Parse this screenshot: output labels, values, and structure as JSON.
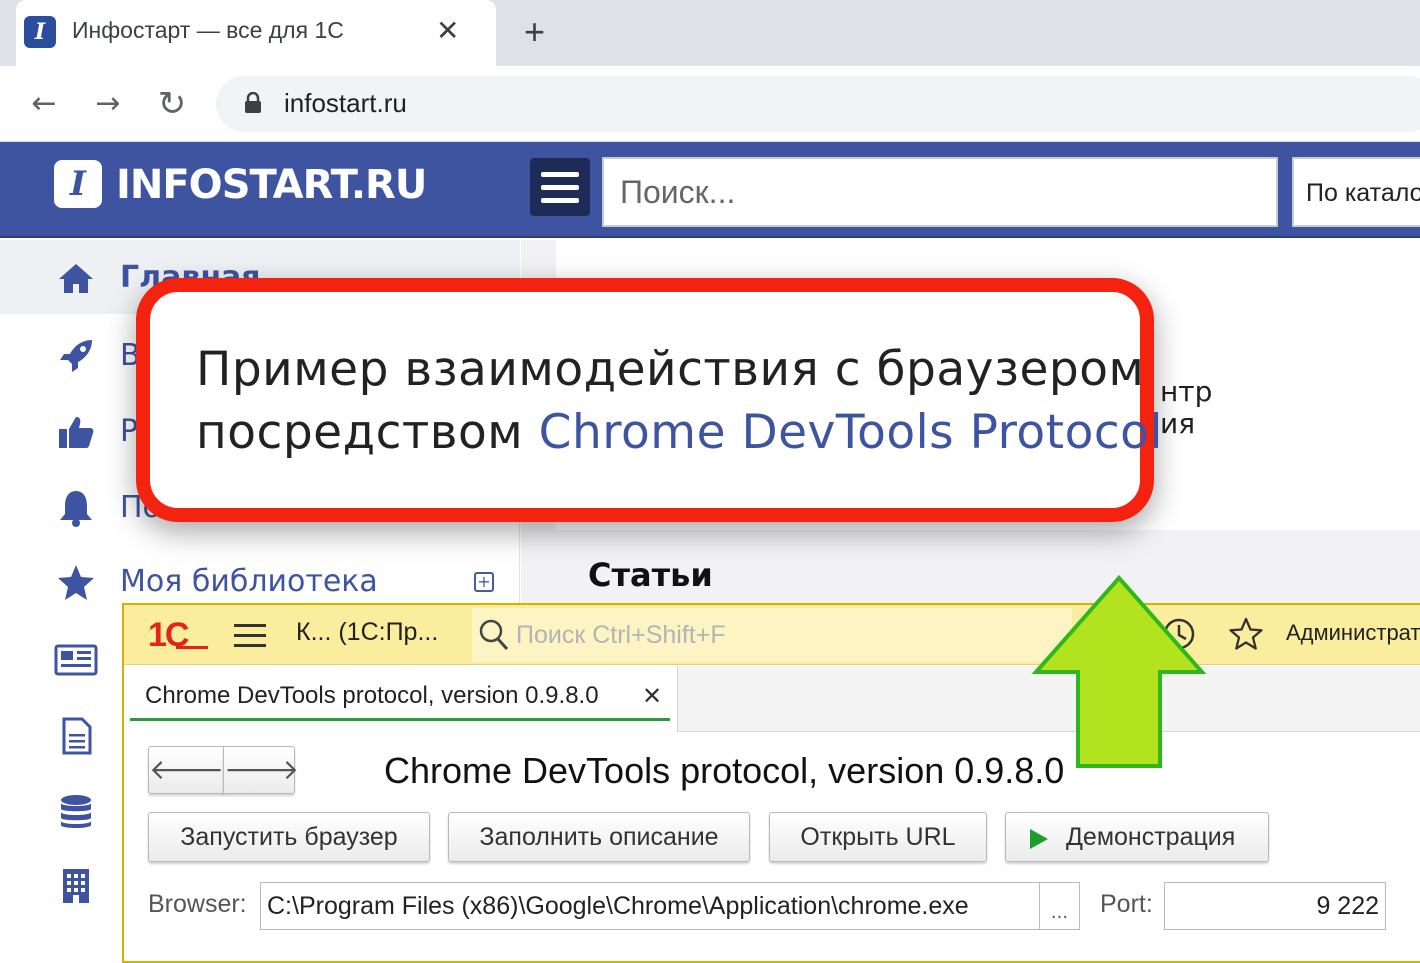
{
  "browser": {
    "tab_title": "Инфостарт — все для 1С",
    "tab_close": "✕",
    "new_tab": "+",
    "url": "infostart.ru",
    "back": "←",
    "forward": "→",
    "reload": "↻"
  },
  "site": {
    "favicon_letter": "I",
    "logo_text": "INFOSTART.RU",
    "search_placeholder": "Поиск...",
    "catalog_select": "По каталогу"
  },
  "sidebar": {
    "items": [
      {
        "label": "Главная",
        "icon": "home-icon"
      },
      {
        "label": "В",
        "icon": "rocket-icon"
      },
      {
        "label": "Р",
        "icon": "thumbs-up-icon"
      },
      {
        "label": "По",
        "icon": "bell-icon"
      },
      {
        "label": "Моя библиотека",
        "icon": "star-icon"
      },
      {
        "label": "",
        "icon": "newspaper-icon"
      },
      {
        "label": "",
        "icon": "document-icon"
      },
      {
        "label": "",
        "icon": "database-icon"
      },
      {
        "label": "",
        "icon": "building-icon"
      }
    ],
    "library_add": "+"
  },
  "main": {
    "partial_line1": "нтр",
    "partial_line2": "ия",
    "articles_tab": "Статьи"
  },
  "onec": {
    "logo": "1С",
    "title": "К... (1С:Пр...",
    "search_placeholder": "Поиск Ctrl+Shift+F",
    "user": "Администратор",
    "tab_label": "Chrome DevTools protocol, version 0.9.8.0",
    "tab_close": "✕",
    "back": "🡐",
    "forward": "🡒",
    "form_title": "Chrome DevTools protocol, version 0.9.8.0",
    "buttons": {
      "launch": "Запустить браузер",
      "fill": "Заполнить описание",
      "open_url": "Открыть URL",
      "demo": "Демонстрация"
    },
    "browser_label": "Browser:",
    "browser_path": "C:\\Program Files (x86)\\Google\\Chrome\\Application\\chrome.exe",
    "browser_choose": "...",
    "port_label": "Port:",
    "port_value": "9 222"
  },
  "callout": {
    "line1": "Пример взаимодействия с браузером",
    "line2_prefix": "посредством ",
    "line2_link": "Chrome DevTools Protocol"
  },
  "colors": {
    "site_brand": "#3e54a0",
    "callout_border": "#f4230f",
    "arrow_fill": "#b3e21e",
    "onec_bar": "#fbed9e",
    "onec_logo": "#e1251b"
  }
}
